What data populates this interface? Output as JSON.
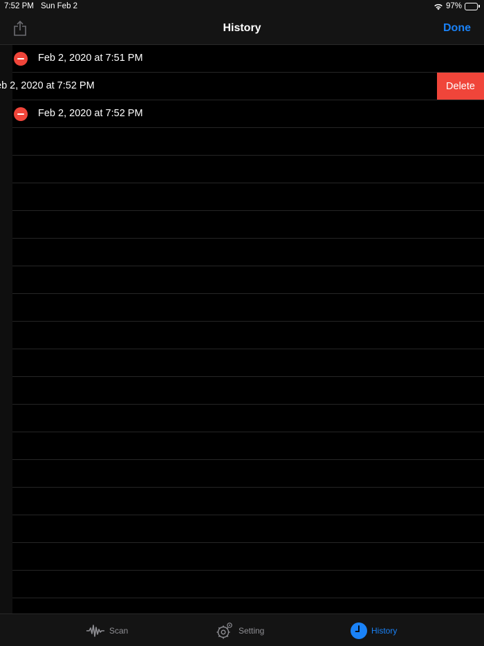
{
  "status_bar": {
    "time": "7:52 PM",
    "date": "Sun Feb 2",
    "battery": "97%"
  },
  "nav": {
    "title": "History",
    "done_label": "Done",
    "share_icon": "share-icon"
  },
  "list": {
    "rows": [
      {
        "label": "Feb 2, 2020 at 7:51 PM"
      },
      {
        "label": "eb 2, 2020 at 7:52 PM",
        "delete_label": "Delete"
      },
      {
        "label": "Feb 2, 2020 at 7:52 PM"
      }
    ]
  },
  "tab_bar": {
    "tabs": [
      {
        "label": "Scan",
        "icon": "waveform-icon"
      },
      {
        "label": "Setting",
        "icon": "gear-icon"
      },
      {
        "label": "History",
        "icon": "clock-icon",
        "active": true
      }
    ]
  },
  "colors": {
    "accent": "#1a82f7",
    "destructive": "#f0453a",
    "background": "#000000",
    "bar": "#141414"
  }
}
